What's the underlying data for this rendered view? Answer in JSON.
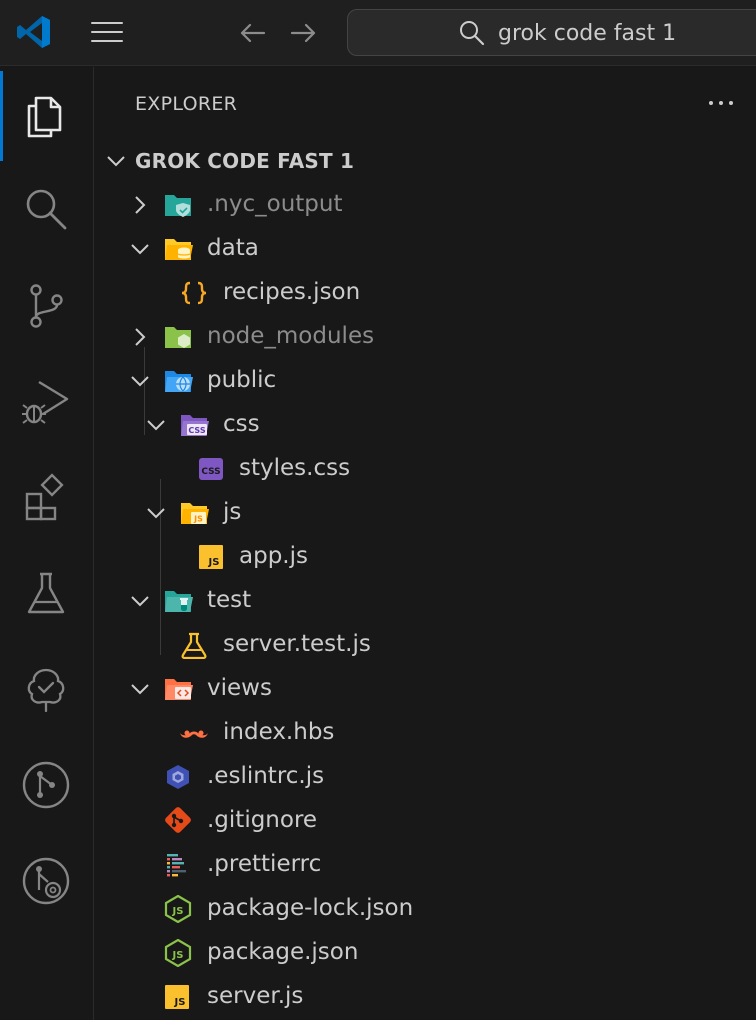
{
  "titlebar": {
    "search_text": "grok code fast 1"
  },
  "activity_bar": {
    "items": [
      {
        "name": "explorer",
        "active": true
      },
      {
        "name": "search"
      },
      {
        "name": "source-control"
      },
      {
        "name": "run-and-debug"
      },
      {
        "name": "extensions"
      },
      {
        "name": "testing"
      },
      {
        "name": "tree-view"
      },
      {
        "name": "git-graph"
      },
      {
        "name": "pull-requests"
      }
    ]
  },
  "sidebar": {
    "title": "EXPLORER",
    "root_label": "GROK CODE FAST 1",
    "tree": [
      {
        "label": ".nyc_output",
        "type": "folder",
        "expanded": false,
        "icon": "folder-shield-icon",
        "dim": true
      },
      {
        "label": "data",
        "type": "folder",
        "expanded": true,
        "icon": "folder-database-icon"
      },
      {
        "label": "recipes.json",
        "type": "file",
        "icon": "json-braces-icon"
      },
      {
        "label": "node_modules",
        "type": "folder",
        "expanded": false,
        "icon": "folder-node-icon",
        "dim": true
      },
      {
        "label": "public",
        "type": "folder",
        "expanded": true,
        "icon": "folder-public-globe-icon"
      },
      {
        "label": "css",
        "type": "folder",
        "expanded": true,
        "icon": "folder-css-icon"
      },
      {
        "label": "styles.css",
        "type": "file",
        "icon": "css-file-icon"
      },
      {
        "label": "js",
        "type": "folder",
        "expanded": true,
        "icon": "folder-js-icon"
      },
      {
        "label": "app.js",
        "type": "file",
        "icon": "js-file-icon"
      },
      {
        "label": "test",
        "type": "folder",
        "expanded": true,
        "icon": "folder-test-icon"
      },
      {
        "label": "server.test.js",
        "type": "file",
        "icon": "flask-test-icon"
      },
      {
        "label": "views",
        "type": "folder",
        "expanded": true,
        "icon": "folder-views-icon"
      },
      {
        "label": "index.hbs",
        "type": "file",
        "icon": "handlebars-mustache-icon"
      },
      {
        "label": ".eslintrc.js",
        "type": "file",
        "icon": "eslint-icon"
      },
      {
        "label": ".gitignore",
        "type": "file",
        "icon": "git-icon"
      },
      {
        "label": ".prettierrc",
        "type": "file",
        "icon": "prettier-icon"
      },
      {
        "label": "package-lock.json",
        "type": "file",
        "icon": "nodejs-icon"
      },
      {
        "label": "package.json",
        "type": "file",
        "icon": "nodejs-icon"
      },
      {
        "label": "server.js",
        "type": "file",
        "icon": "js-file-icon"
      }
    ]
  },
  "colors": {
    "accent": "#0078d4",
    "background": "#181818",
    "text": "#cccccc"
  }
}
